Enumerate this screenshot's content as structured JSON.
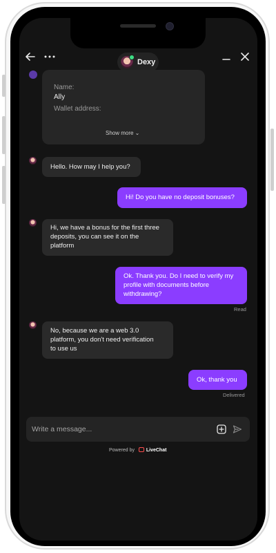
{
  "header": {
    "back_icon": "arrow-left-icon",
    "more_icon": "more-horizontal-icon",
    "agent_name": "Dexy",
    "minimize_icon": "minimize-icon",
    "close_icon": "close-icon"
  },
  "form_card": {
    "name_label": "Name:",
    "name_value": "Ally",
    "wallet_label": "Wallet address:",
    "show_more": "Show more ⌄"
  },
  "messages": [
    {
      "from": "agent",
      "lines": [
        "Hello. How may I help you?"
      ]
    },
    {
      "from": "user",
      "lines": [
        "Hi! Do you have no deposit bonuses?"
      ]
    },
    {
      "from": "agent",
      "lines": [
        "Hi, we have a bonus for the first three",
        "deposits, you can see it on the",
        "platform"
      ]
    },
    {
      "from": "user",
      "lines": [
        "Ok. Thank you. Do I need to verify my",
        "profile with documents before",
        "withdrawing?"
      ],
      "status": "Read"
    },
    {
      "from": "agent",
      "lines": [
        "No, because we are a web 3.0",
        "platform, you don't need verification",
        "to use us"
      ]
    },
    {
      "from": "user",
      "lines": [
        "Ok, thank you"
      ],
      "status": "Delivered"
    }
  ],
  "composer": {
    "placeholder": "Write a message...",
    "attach_icon": "add-square-icon",
    "send_icon": "send-icon"
  },
  "footer": {
    "powered_by": "Powered by",
    "brand": "LiveChat"
  },
  "colors": {
    "accent": "#8b3dff",
    "background": "#141414",
    "agent_bubble": "#2a2a2a"
  }
}
